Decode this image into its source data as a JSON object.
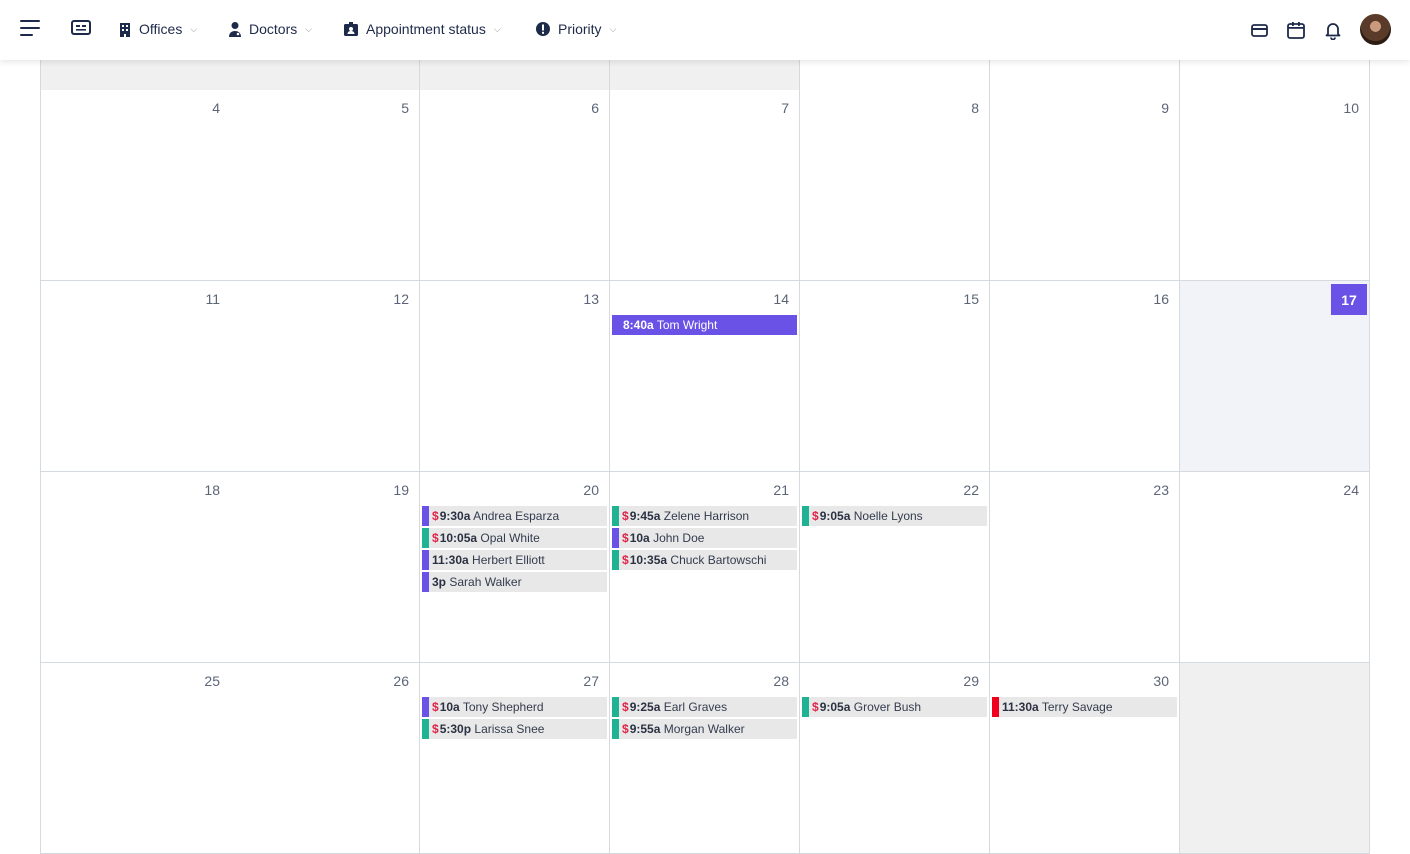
{
  "nav": {
    "items": [
      {
        "label": "Offices",
        "icon": "building-icon"
      },
      {
        "label": "Doctors",
        "icon": "doctor-icon"
      },
      {
        "label": "Appointment status",
        "icon": "id-badge-icon"
      },
      {
        "label": "Priority",
        "icon": "exclamation-circle-icon"
      }
    ],
    "chevron": "⌵"
  },
  "colors": {
    "accent": "#6b52e6",
    "teal": "#1fb394",
    "red": "#f0001c",
    "dollar": "#e0254a"
  },
  "calendar": {
    "today": "17",
    "weeks": [
      {
        "days": [
          {
            "num": "",
            "state": "shaded"
          },
          {
            "num": "",
            "state": "shaded"
          },
          {
            "num": "",
            "state": "shaded"
          },
          {
            "num": "",
            "state": "shaded"
          },
          {
            "num": "",
            "state": ""
          },
          {
            "num": "",
            "state": ""
          },
          {
            "num": "",
            "state": ""
          }
        ]
      },
      {
        "days": [
          {
            "num": "4"
          },
          {
            "num": "5"
          },
          {
            "num": "6"
          },
          {
            "num": "7"
          },
          {
            "num": "8"
          },
          {
            "num": "9"
          },
          {
            "num": "10"
          }
        ]
      },
      {
        "days": [
          {
            "num": "11"
          },
          {
            "num": "12"
          },
          {
            "num": "13"
          },
          {
            "num": "14",
            "events": [
              {
                "time": "8:40a",
                "name": "Tom Wright",
                "style": "solid"
              }
            ]
          },
          {
            "num": "15"
          },
          {
            "num": "16"
          },
          {
            "num": "17",
            "state": "today"
          }
        ]
      },
      {
        "days": [
          {
            "num": "18"
          },
          {
            "num": "19"
          },
          {
            "num": "20",
            "events": [
              {
                "time": "9:30a",
                "name": "Andrea Esparza",
                "color": "purple",
                "paid": true
              },
              {
                "time": "10:05a",
                "name": "Opal White",
                "color": "teal",
                "paid": true
              },
              {
                "time": "11:30a",
                "name": "Herbert Elliott",
                "color": "purple",
                "paid": false
              },
              {
                "time": "3p",
                "name": "Sarah Walker",
                "color": "purple",
                "paid": false
              }
            ]
          },
          {
            "num": "21",
            "events": [
              {
                "time": "9:45a",
                "name": "Zelene Harrison",
                "color": "teal",
                "paid": true
              },
              {
                "time": "10a",
                "name": "John Doe",
                "color": "purple",
                "paid": true
              },
              {
                "time": "10:35a",
                "name": "Chuck Bartowschi",
                "color": "teal",
                "paid": true
              }
            ]
          },
          {
            "num": "22",
            "events": [
              {
                "time": "9:05a",
                "name": "Noelle Lyons",
                "color": "teal",
                "paid": true
              }
            ]
          },
          {
            "num": "23"
          },
          {
            "num": "24"
          }
        ]
      },
      {
        "days": [
          {
            "num": "25"
          },
          {
            "num": "26"
          },
          {
            "num": "27",
            "events": [
              {
                "time": "10a",
                "name": "Tony Shepherd",
                "color": "purple",
                "paid": true
              },
              {
                "time": "5:30p",
                "name": "Larissa Snee",
                "color": "teal",
                "paid": true
              }
            ]
          },
          {
            "num": "28",
            "events": [
              {
                "time": "9:25a",
                "name": "Earl Graves",
                "color": "teal",
                "paid": true
              },
              {
                "time": "9:55a",
                "name": "Morgan Walker",
                "color": "teal",
                "paid": true
              }
            ]
          },
          {
            "num": "29",
            "events": [
              {
                "time": "9:05a",
                "name": "Grover Bush",
                "color": "teal",
                "paid": true
              }
            ]
          },
          {
            "num": "30",
            "events": [
              {
                "time": "11:30a",
                "name": "Terry Savage",
                "color": "red",
                "paid": false
              }
            ]
          },
          {
            "num": "",
            "state": "shaded"
          }
        ]
      }
    ]
  }
}
